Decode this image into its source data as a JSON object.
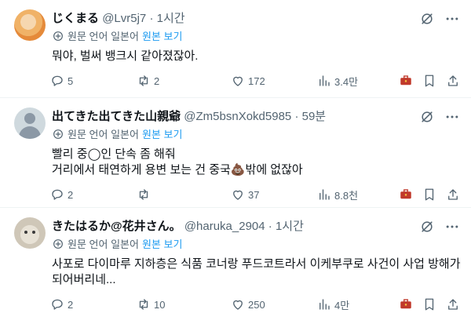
{
  "colors": {
    "link": "#1d9bf0",
    "muted": "#536471",
    "text": "#0f1419"
  },
  "translate_bar": {
    "label": "원문 언어 일본어",
    "link": "원본 보기"
  },
  "tweets": [
    {
      "name": "じくまる",
      "handle": "@Lvr5j7",
      "time": "· 1시간",
      "text_lines": [
        "뭐야, 벌써 뱅크시 같아졌잖아."
      ],
      "stats": {
        "replies": "5",
        "retweets": "2",
        "likes": "172",
        "views": "3.4만"
      }
    },
    {
      "name": "出てきた出てきた山親爺",
      "handle": "@Zm5bsnXokd5985",
      "time": "· 59분",
      "text_lines": [
        "빨리 중◯인 단속 좀 해줘",
        "거리에서 태연하게 용변 보는 건 중국💩밖에 없잖아"
      ],
      "stats": {
        "replies": "2",
        "retweets": "",
        "likes": "37",
        "views": "8.8천"
      }
    },
    {
      "name": "きたはるか@花井さん。",
      "handle": "@haruka_2904",
      "time": "· 1시간",
      "text_lines": [
        "사포로 다이마루 지하층은 식품 코너랑 푸드코트라서 이케부쿠로 사건이 사업 방해가",
        "되어버리네..."
      ],
      "stats": {
        "replies": "2",
        "retweets": "10",
        "likes": "250",
        "views": "4만"
      }
    }
  ]
}
